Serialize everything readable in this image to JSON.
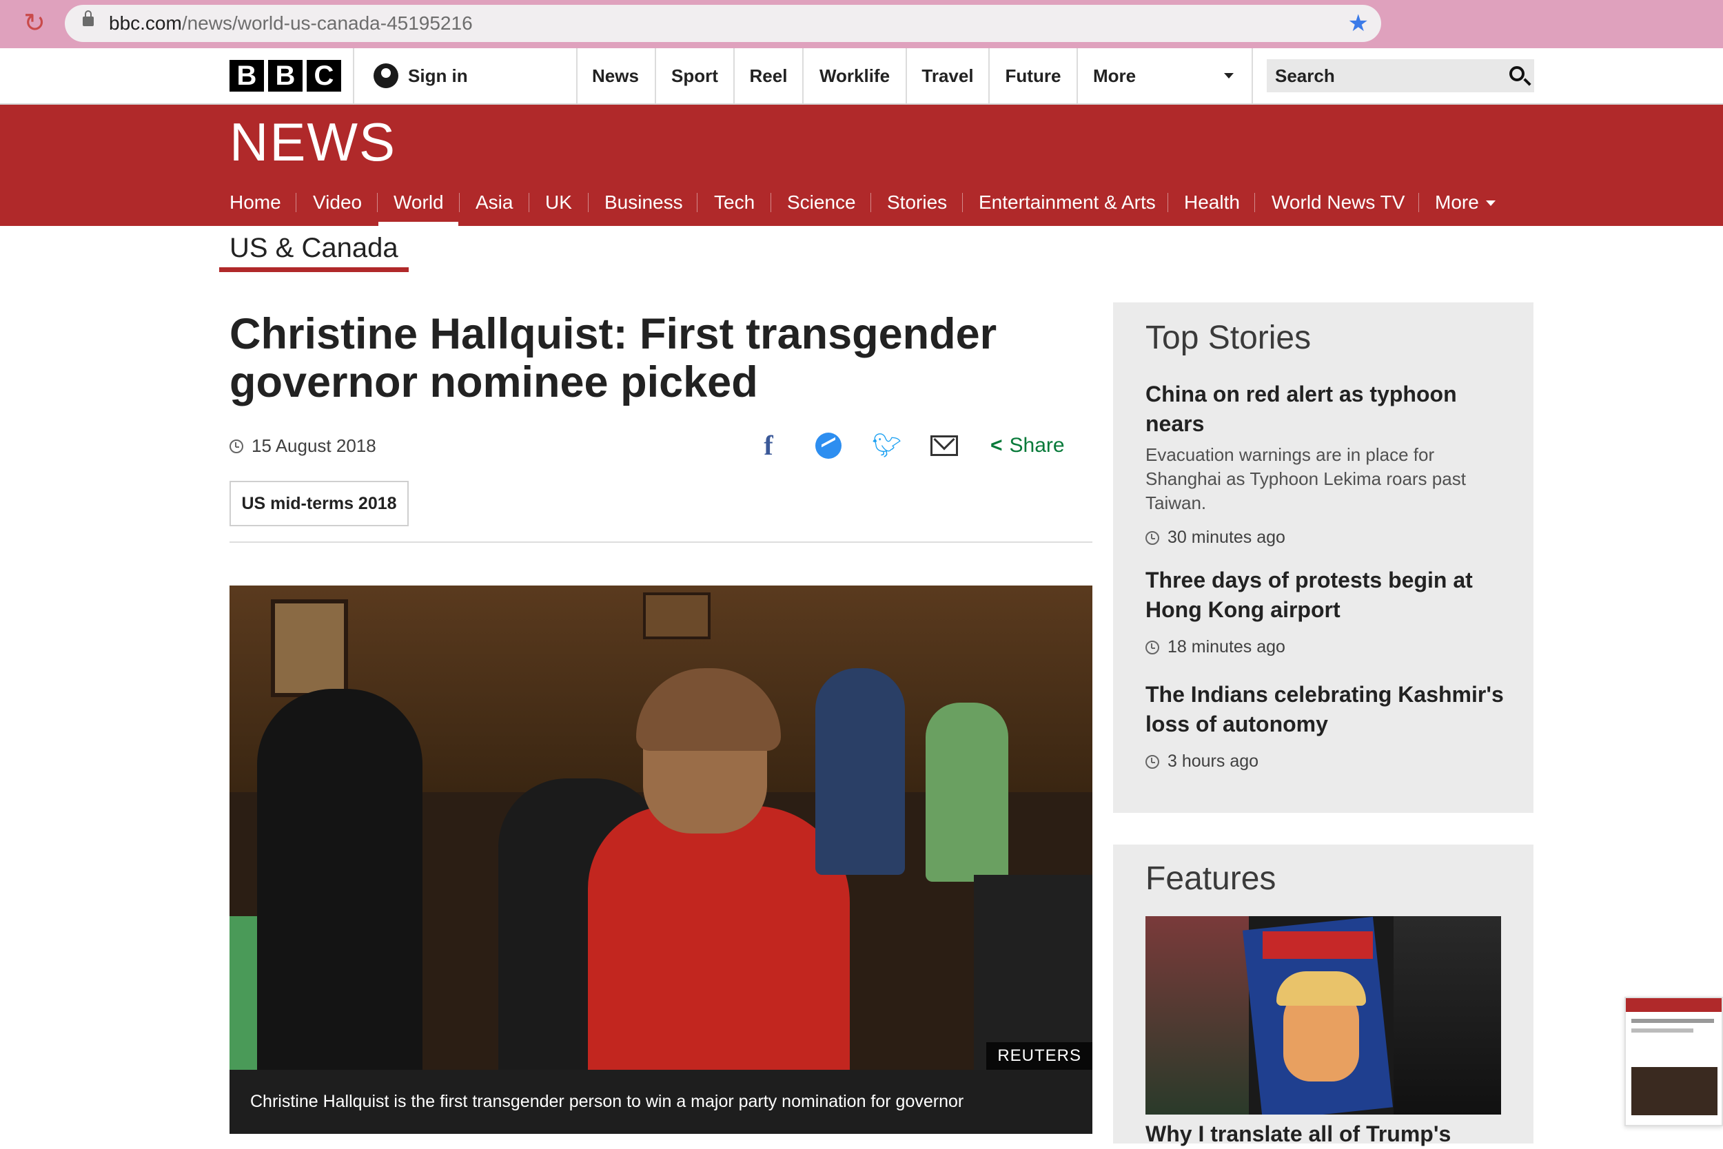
{
  "browser": {
    "url_host": "bbc.com",
    "url_path": "/news/world-us-canada-45195216"
  },
  "global_nav": {
    "logo_letters": [
      "B",
      "B",
      "C"
    ],
    "sign_in": "Sign in",
    "items": [
      "News",
      "Sport",
      "Reel",
      "Worklife",
      "Travel",
      "Future",
      "More"
    ],
    "search_label": "Search"
  },
  "masthead": {
    "wordmark": "NEWS"
  },
  "section_nav": {
    "items": [
      "Home",
      "Video",
      "World",
      "Asia",
      "UK",
      "Business",
      "Tech",
      "Science",
      "Stories",
      "Entertainment & Arts",
      "Health",
      "World News TV",
      "More"
    ],
    "active": "World"
  },
  "subsection": "US & Canada",
  "article": {
    "headline": "Christine Hallquist: First transgender governor nominee picked",
    "date": "15 August 2018",
    "share_label": "Share",
    "tag": "US mid-terms 2018",
    "image_credit": "REUTERS",
    "caption": "Christine Hallquist is the first transgender person to win a major party nomination for governor"
  },
  "sidebar": {
    "top_stories_heading": "Top Stories",
    "stories": [
      {
        "title": "China on red alert as typhoon nears",
        "summary": "Evacuation warnings are in place for Shanghai as Typhoon Lekima roars past Taiwan.",
        "time": "30 minutes ago"
      },
      {
        "title": "Three days of protests begin at Hong Kong airport",
        "summary": "",
        "time": "18 minutes ago"
      },
      {
        "title": "The Indians celebrating Kashmir's loss of autonomy",
        "summary": "",
        "time": "3 hours ago"
      }
    ],
    "features_heading": "Features",
    "feature_title": "Why I translate all of Trump's"
  },
  "colors": {
    "bbc_red": "#b0292a",
    "share_green": "#087a3a",
    "browser_bar": "#dfa1bd"
  }
}
